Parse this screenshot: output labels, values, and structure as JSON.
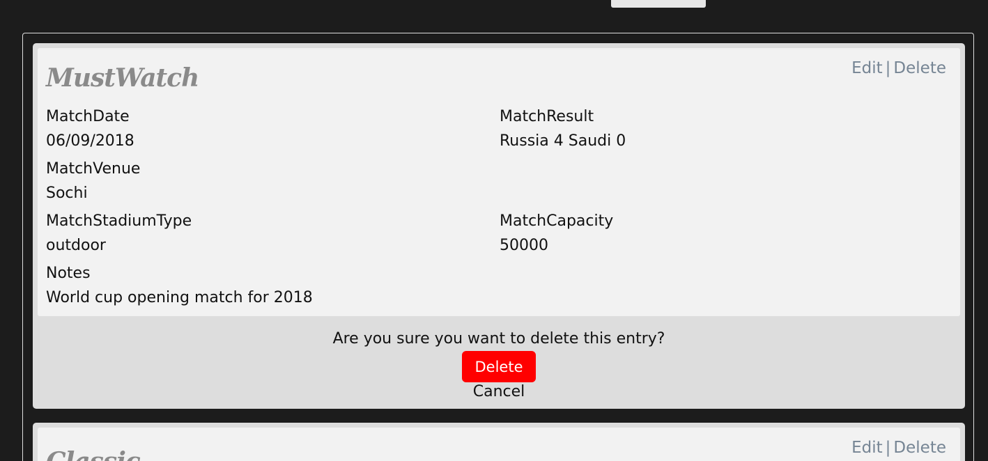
{
  "entries": [
    {
      "title": "MustWatch",
      "actions": {
        "edit": "Edit",
        "separator": "|",
        "delete": "Delete"
      },
      "fields": {
        "match_date": {
          "label": "MatchDate",
          "value": "06/09/2018"
        },
        "match_result": {
          "label": "MatchResult",
          "value": "Russia 4 Saudi 0"
        },
        "match_venue": {
          "label": "MatchVenue",
          "value": "Sochi"
        },
        "stadium_type": {
          "label": "MatchStadiumType",
          "value": "outdoor"
        },
        "capacity": {
          "label": "MatchCapacity",
          "value": "50000"
        },
        "notes": {
          "label": "Notes",
          "value": "World cup opening match for 2018"
        }
      },
      "confirm": {
        "question": "Are you sure you want to delete this entry?",
        "delete_label": "Delete",
        "cancel_label": "Cancel"
      }
    },
    {
      "title": "Classic",
      "actions": {
        "edit": "Edit",
        "separator": "|",
        "delete": "Delete"
      }
    }
  ],
  "colors": {
    "background": "#1c1c1c",
    "card": "#f2f2f2",
    "confirm_panel": "#dddddd",
    "link": "#768594",
    "danger": "#ff0000",
    "title": "#8a8a8a"
  }
}
